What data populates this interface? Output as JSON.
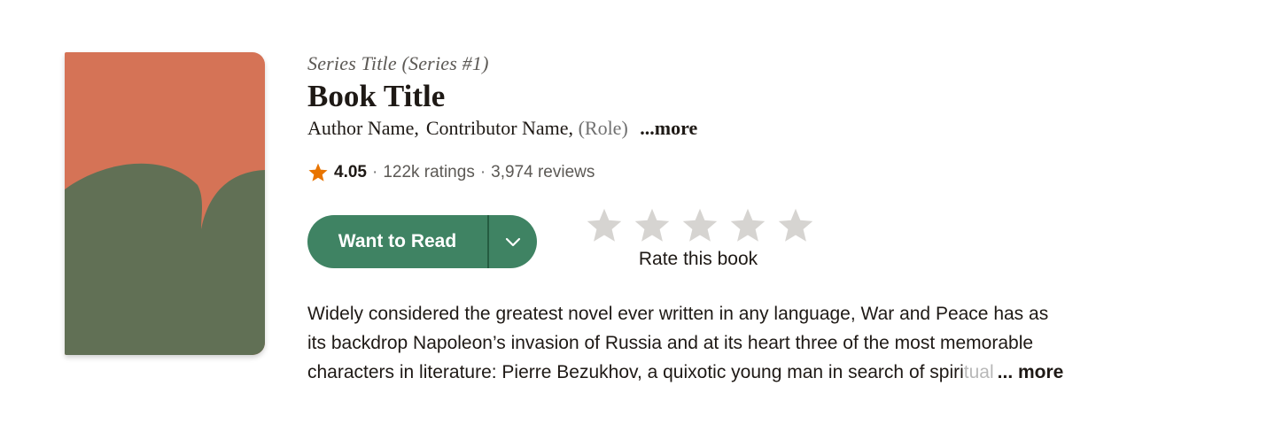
{
  "colors": {
    "cover_top": "#d57356",
    "cover_bottom": "#617055",
    "button_green": "#3f8363",
    "star_orange": "#e87400",
    "star_empty": "#d6d4d1"
  },
  "book": {
    "series": "Series Title (Series #1)",
    "title": "Book Title",
    "author": "Author Name,",
    "contributor": "Contributor Name,",
    "role": "(Role)",
    "more_authors": "...more"
  },
  "rating": {
    "star_icon": "star-icon",
    "average": "4.05",
    "separator": "·",
    "ratings": "122k ratings",
    "reviews": "3,974 reviews"
  },
  "actions": {
    "want_to_read": "Want to Read",
    "dropdown_icon": "chevron-down-icon",
    "rate_label": "Rate this book",
    "rate_stars": 5
  },
  "description": {
    "line1": "Widely considered the greatest novel ever written in any language, War and Peace has as",
    "line2": "its backdrop Napoleon’s invasion of Russia and at its heart three of the most memorable",
    "line3": "characters in literature: Pierre Bezukhov, a quixotic young man in search of spiri",
    "line3_fade": "tual",
    "more": "... more"
  }
}
